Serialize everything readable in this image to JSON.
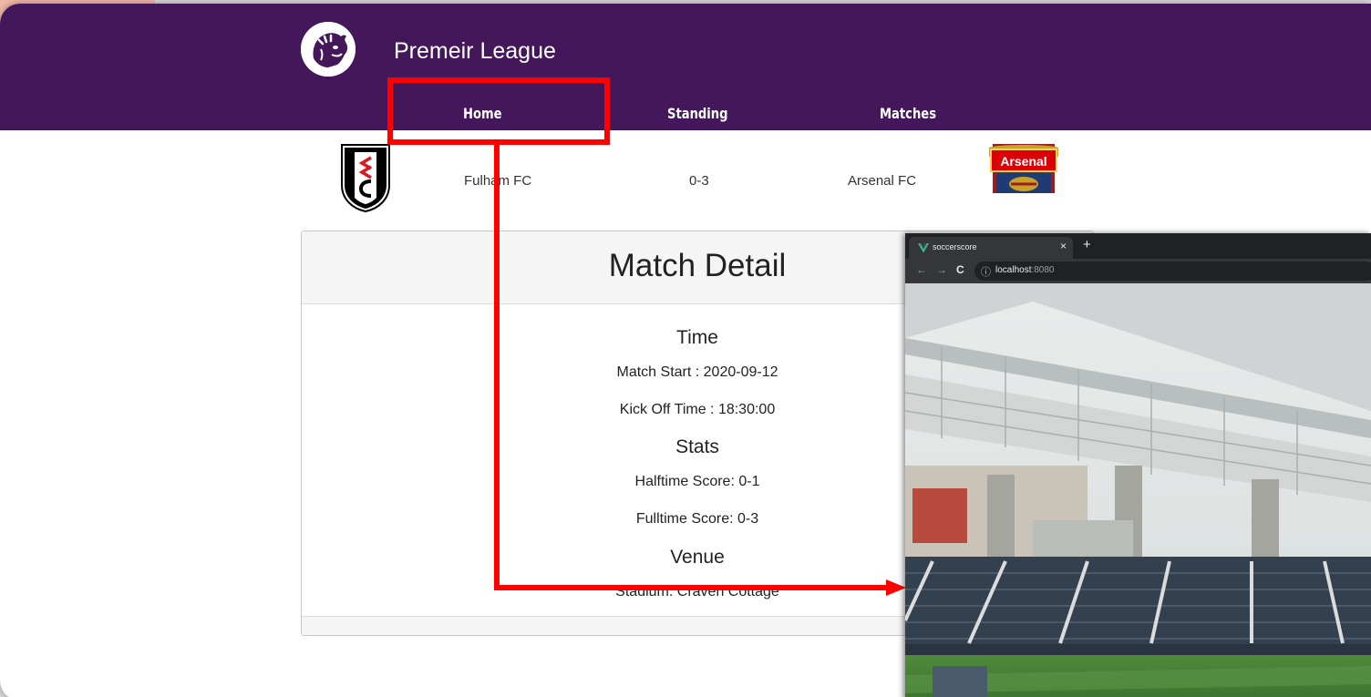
{
  "header": {
    "title": "Premeir League",
    "nav": [
      {
        "label": "Home"
      },
      {
        "label": "Standing"
      },
      {
        "label": "Matches"
      }
    ]
  },
  "match": {
    "home_team": "Fulham FC",
    "score": "0-3",
    "away_team": "Arsenal FC",
    "away_crest_text": "Arsenal"
  },
  "detail": {
    "title": "Match Detail",
    "time_heading": "Time",
    "match_start": "Match Start : 2020-09-12",
    "kickoff": "Kick Off Time : 18:30:00",
    "stats_heading": "Stats",
    "halftime": "Halftime Score: 0-1",
    "fulltime": "Fulltime Score: 0-3",
    "venue_heading": "Venue",
    "stadium": "Stadium: Craven Cottage"
  },
  "browser": {
    "tab_title": "soccerscore",
    "tab_close": "×",
    "new_tab": "+",
    "host": "localhost",
    "port": ":8080",
    "back": "←",
    "forward": "→",
    "reload": "C",
    "info": "ⓘ"
  },
  "colors": {
    "header": "#43175a",
    "highlight": "#ff0000",
    "browser_chrome": "#202124"
  },
  "icons": [
    "premier-league-lion-icon",
    "fulham-crest-icon",
    "arsenal-crest-icon",
    "vue-icon"
  ]
}
